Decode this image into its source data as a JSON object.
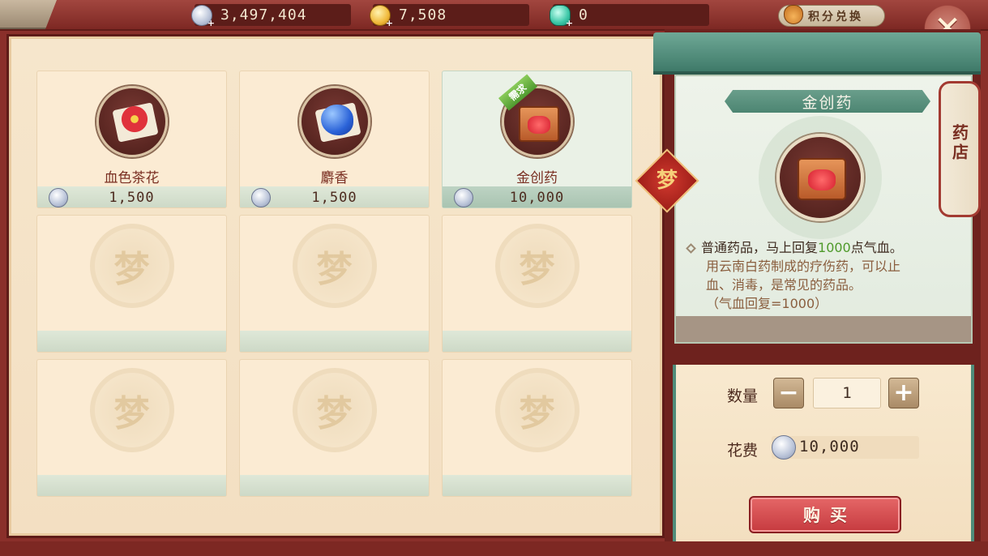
{
  "currencies": [
    {
      "id": "silver",
      "icon": "silver-coin-icon",
      "value": "3,497,404"
    },
    {
      "id": "gold",
      "icon": "gold-coin-icon",
      "value": "7,508"
    },
    {
      "id": "jade",
      "icon": "jade-icon",
      "value": "0"
    }
  ],
  "header": {
    "exchange_label": "积分兑换",
    "close_label": "✕"
  },
  "shop": {
    "items": [
      {
        "name": "血色茶花",
        "price": "1,500",
        "icon": "camellia-icon",
        "selected": false,
        "badge": ""
      },
      {
        "name": "麝香",
        "price": "1,500",
        "icon": "musk-icon",
        "selected": false,
        "badge": ""
      },
      {
        "name": "金创药",
        "price": "10,000",
        "icon": "medicine-box-icon",
        "selected": true,
        "badge": "需求"
      }
    ],
    "empty_slot_mark": "梦",
    "empty_slots": 6
  },
  "detail": {
    "title": "金创药",
    "desc_prefix": "普通药品，马上回复",
    "desc_highlight": "1000",
    "desc_suffix": "点气血。",
    "desc_line2": "用云南白药制成的疗伤药，可以止",
    "desc_line3": "血、消毒，是常见的药品。",
    "desc_line4": "（气血回复=1000）",
    "highlight_color": "#4e9a2a"
  },
  "side_tab": {
    "label": "药店"
  },
  "knot": {
    "mark": "梦"
  },
  "purchase": {
    "quantity_label": "数量",
    "quantity_value": "1",
    "minus_label": "−",
    "plus_label": "+",
    "cost_label": "花费",
    "cost_value": "10,000",
    "buy_label": "购买"
  }
}
